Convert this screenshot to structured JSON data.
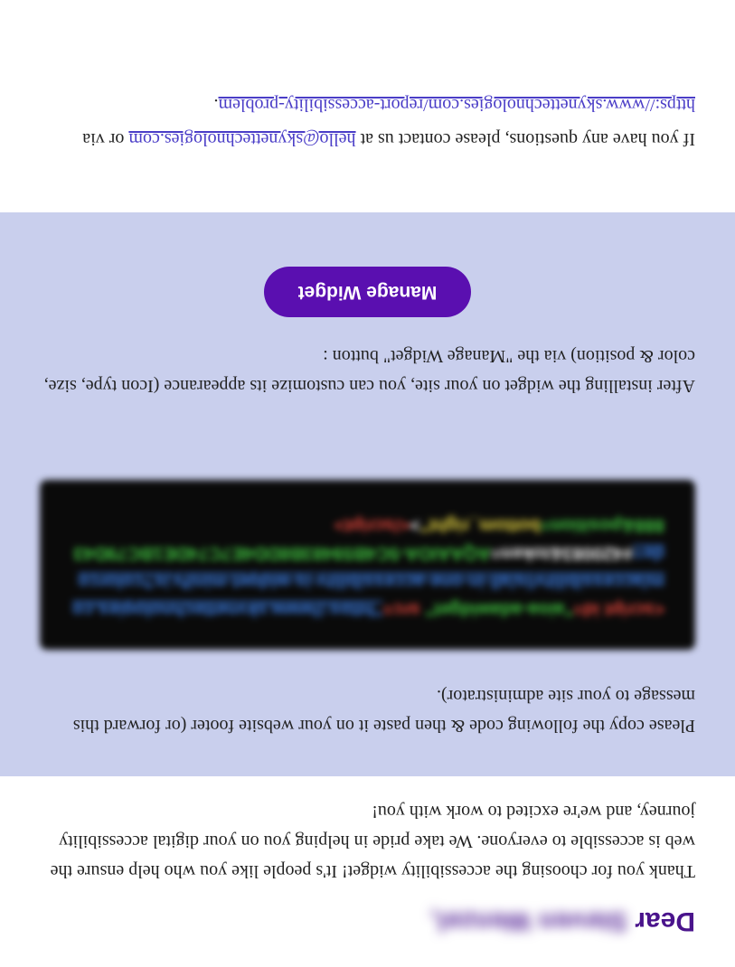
{
  "greeting": {
    "prefix": "Dear ",
    "name": "Steven Wenzel,"
  },
  "intro": "Thank you for choosing the accessibility widget! It's people like you who help ensure the web is accessible to everyone. We take pride in helping you on your digital accessibility journey, and we're excited to work with you!",
  "instructions": {
    "copy_text": "Please copy the following code & then paste it on your website footer (or forward this message to your site administrator).",
    "code": {
      "t1": "<script id=",
      "t2": "\"aioa-adawidget\" ",
      "t3": "src=",
      "t4": "\"https://www.skynettechnologies.com/accessibility/js/all-in-one-accessibility-js-widget-minify.js?colorcode=",
      "t5": "#420083&token=",
      "t6": "AQAAIOA-5C4B59483B8DD4E7C74DE1BC79D43888&position=",
      "t7": "bottom_right\"",
      "t8": ">",
      "t9": "</script>"
    },
    "after_text": "After installing the widget on your site, you can customize its appearance (Icon type, size, color & position) via the \"Manage Widget\" button :",
    "manage_button": "Manage Widget"
  },
  "footer": {
    "pre": "If you have any questions, please contact us at ",
    "email": "hello@skynettechnologies.com",
    "mid": " or via ",
    "url": "https://www.skynettechnologies.com/report-accessibility-problem",
    "end": "."
  },
  "colors": {
    "brand_purple": "#5a0fb0",
    "band_bg": "#c9cfed",
    "link": "#4a3dc7"
  }
}
